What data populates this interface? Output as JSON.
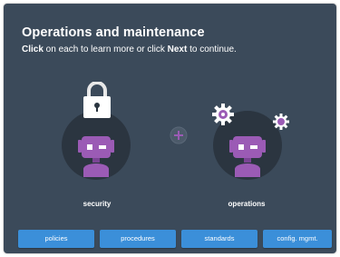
{
  "header": {
    "title": "Operations and maintenance",
    "instruction_part1": "Click",
    "instruction_part2": " on each to learn more or click ",
    "instruction_part3": "Next",
    "instruction_part4": " to continue."
  },
  "figures": [
    {
      "label": "security",
      "icon": "padlock-icon"
    },
    {
      "label": "operations",
      "icon": "gears-icon"
    }
  ],
  "plus_icon": "plus-icon",
  "buttons": [
    {
      "label": "policies"
    },
    {
      "label": "procedures"
    },
    {
      "label": "standards"
    },
    {
      "label": "config. mgmt."
    }
  ],
  "colors": {
    "background": "#3b4a5a",
    "circle": "#2b3540",
    "robot": "#9b5bb5",
    "button": "#3b8fd9"
  }
}
